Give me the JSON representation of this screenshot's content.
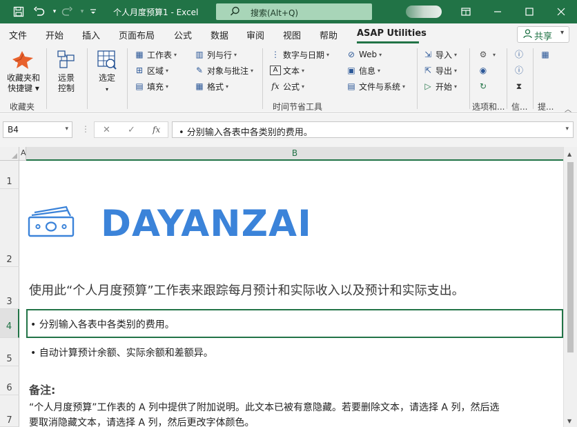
{
  "titlebar": {
    "doc_title": "个人月度预算1  -  Excel",
    "search_placeholder": "搜索(Alt+Q)",
    "icons": [
      "save-icon",
      "undo-icon",
      "redo-icon",
      "customize-icon",
      "search-icon",
      "ribbon-display-icon",
      "minimize-icon",
      "maximize-icon",
      "close-icon"
    ]
  },
  "tabs": {
    "items": [
      "文件",
      "开始",
      "插入",
      "页面布局",
      "公式",
      "数据",
      "审阅",
      "视图",
      "帮助",
      "ASAP Utilities"
    ],
    "active": "ASAP Utilities",
    "share_label": "共享"
  },
  "ribbon": {
    "favorites": {
      "button_label": "收藏夹和\n快捷键",
      "group_label": "收藏夹"
    },
    "remote": {
      "button_label": "远景\n控制"
    },
    "select": {
      "button_label": "选定"
    },
    "col1": [
      "工作表",
      "区域",
      "填充"
    ],
    "col2": [
      "列与行",
      "对象与批注",
      "格式"
    ],
    "col3": [
      "数字与日期",
      "文本",
      "公式"
    ],
    "col4": [
      "Web",
      "信息",
      "文件与系统"
    ],
    "col5": [
      "导入",
      "导出",
      "开始"
    ],
    "time_group_label": "时间节省工具",
    "options_label": "选项和...",
    "info_label": "信...",
    "tips_label": "提..."
  },
  "formula_bar": {
    "name_box": "B4",
    "fx": "fx",
    "value": "• 分别输入各表中各类别的费用。"
  },
  "grid": {
    "col_a": "A",
    "col_b": "B",
    "rows": [
      "1",
      "2",
      "3",
      "4",
      "5",
      "6",
      "7"
    ],
    "selected_row": "4",
    "brand": "DAYANZAI",
    "intro": "使用此“个人月度预算”工作表来跟踪每月预计和实际收入以及预计和实际支出。",
    "bullet1": "• 分别输入各表中各类别的费用。",
    "bullet2": "• 自动计算预计余额、实际余额和差额异。",
    "note_heading": "备注:",
    "note_line1": "“个人月度预算”工作表的 A 列中提供了附加说明。此文本已被有意隐藏。若要删除文本，请选择 A 列，然后选",
    "note_line2": "要取消隐藏文本，请选择 A 列，然后更改字体颜色。"
  },
  "colors": {
    "excel_green": "#217346",
    "brand_blue": "#3b83d9"
  }
}
